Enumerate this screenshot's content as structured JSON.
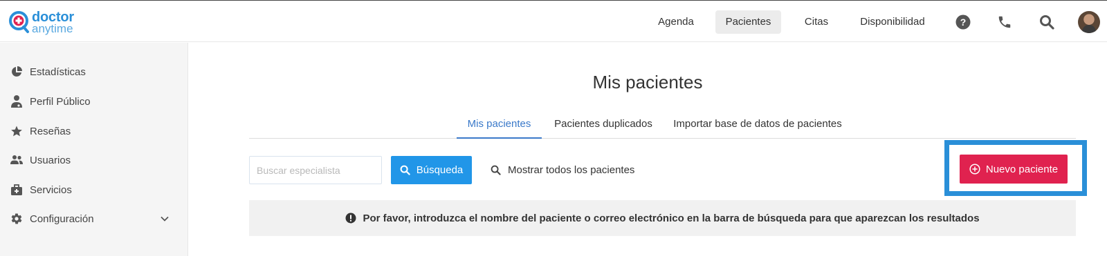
{
  "logo": {
    "word1": "doctor",
    "word2": "anytime"
  },
  "nav": {
    "items": [
      {
        "label": "Agenda",
        "active": false
      },
      {
        "label": "Pacientes",
        "active": true
      },
      {
        "label": "Citas",
        "active": false
      },
      {
        "label": "Disponibilidad",
        "active": false
      }
    ],
    "icons": [
      "help-icon",
      "phone-icon",
      "search-icon",
      "avatar"
    ]
  },
  "sidebar": {
    "items": [
      {
        "label": "Estadísticas",
        "icon": "pie-chart-icon"
      },
      {
        "label": "Perfil Público",
        "icon": "doctor-profile-icon"
      },
      {
        "label": "Reseñas",
        "icon": "star-icon"
      },
      {
        "label": "Usuarios",
        "icon": "users-icon"
      },
      {
        "label": "Servicios",
        "icon": "medical-kit-icon"
      },
      {
        "label": "Configuración",
        "icon": "gear-icon",
        "expandable": true
      }
    ]
  },
  "main": {
    "title": "Mis pacientes",
    "tabs": [
      {
        "label": "Mis pacientes",
        "active": true
      },
      {
        "label": "Pacientes duplicados",
        "active": false
      },
      {
        "label": "Importar base de datos de pacientes",
        "active": false
      }
    ],
    "search": {
      "placeholder": "Buscar especialista",
      "value": "",
      "button_label": "Búsqueda"
    },
    "show_all_label": "Mostrar todos los pacientes",
    "new_patient_label": "Nuevo paciente",
    "notice": "Por favor, introduzca el nombre del paciente o correo electrónico en la barra de búsqueda para que aparezcan los resultados"
  },
  "colors": {
    "brand_blue": "#2a8fd8",
    "search_button": "#2196e8",
    "new_patient_button": "#e0224f",
    "active_tab": "#3a79c9"
  }
}
